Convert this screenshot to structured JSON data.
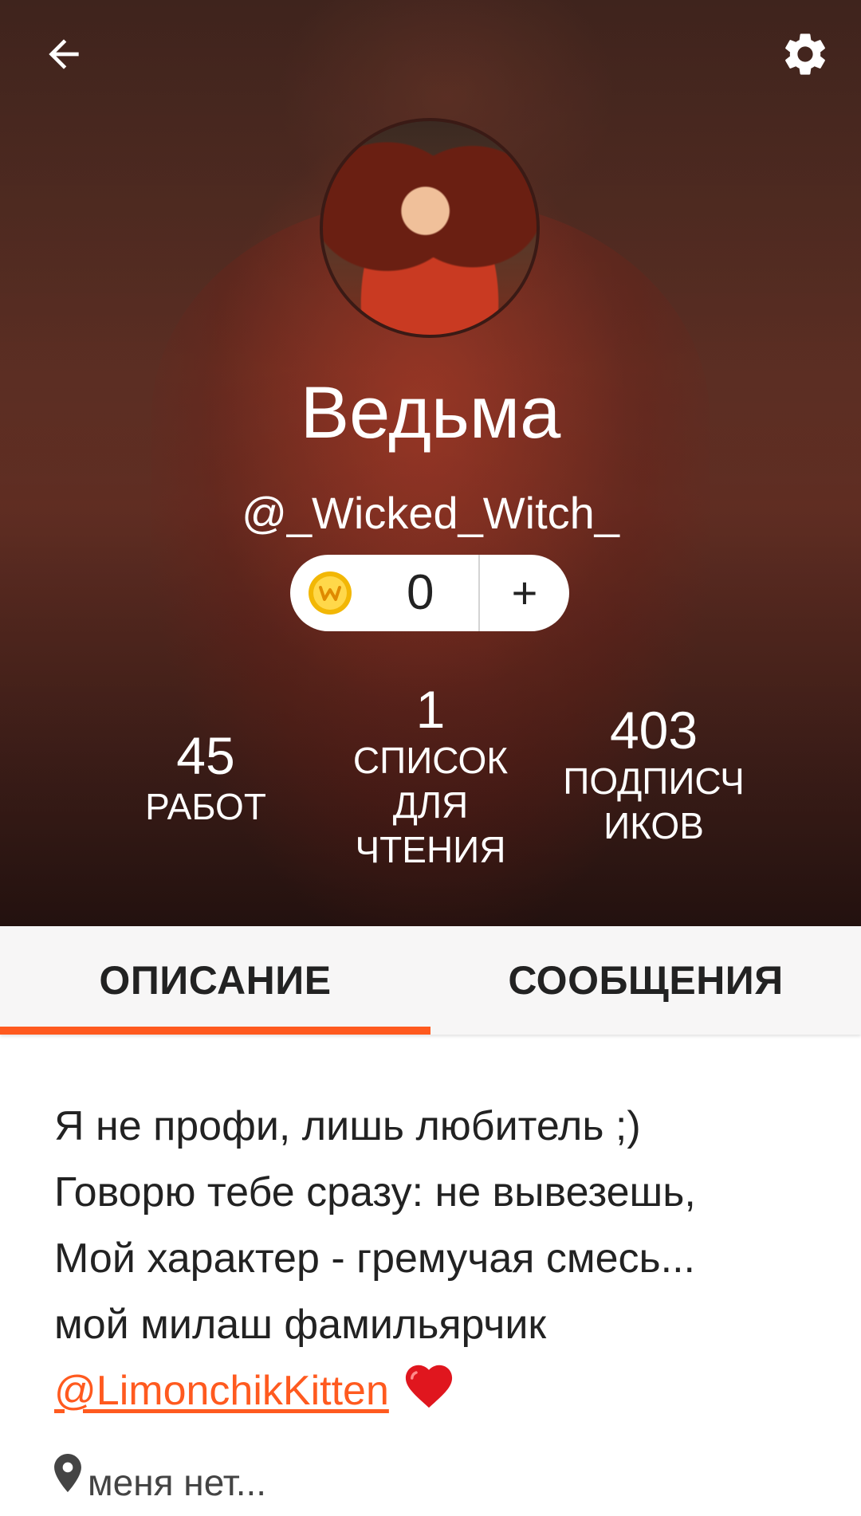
{
  "header": {
    "back_icon": "arrow-left-icon",
    "settings_icon": "gear-icon",
    "display_name": "Ведьма",
    "username": "@_Wicked_Witch_"
  },
  "coins": {
    "icon": "wattpad-coin-icon",
    "count": "0",
    "add_label": "+"
  },
  "stats": {
    "works": {
      "value": "45",
      "label": "РАБОТ"
    },
    "reading_lists": {
      "value": "1",
      "label_lines": [
        "СПИСОК",
        "ДЛЯ",
        "ЧТЕНИЯ"
      ]
    },
    "followers": {
      "value": "403",
      "label_lines": [
        "ПОДПИСЧ",
        "ИКОВ"
      ]
    }
  },
  "tabs": [
    {
      "label": "ОПИСАНИЕ",
      "active": true
    },
    {
      "label": "СООБЩЕНИЯ",
      "active": false
    }
  ],
  "about": {
    "lines": [
      "Я не профи, лишь любитель ;)",
      "Говорю тебе сразу: не вывезешь,",
      "Мой характер - гремучая смесь...",
      "мой милаш фамильярчик"
    ],
    "mention": "@LimonchikKitten",
    "emoji": "heart-icon"
  },
  "location": {
    "icon": "location-pin-icon",
    "text": "меня нет..."
  },
  "colors": {
    "accent": "#ff5a1f",
    "tab_bar_bg": "#f7f6f6",
    "text_primary": "#222222"
  }
}
